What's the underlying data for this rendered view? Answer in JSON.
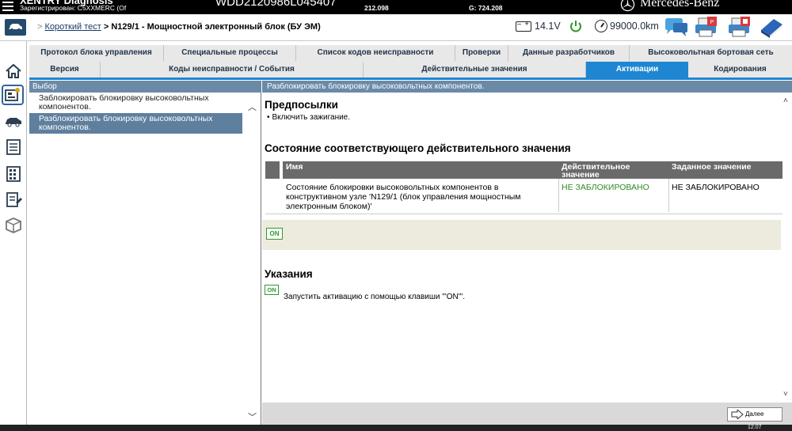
{
  "topbar": {
    "brand": "XENTRY Diagnosis",
    "registered": "Зарегистрирован: C5XXMERC (Of",
    "vin": "WDD2120986L045407",
    "code": "212.098",
    "gcode": "G: 724.208",
    "mb_text": "Mercedes-Benz"
  },
  "header": {
    "breadcrumb_sep": ">",
    "breadcrumb_link": "Короткий тест",
    "breadcrumb_current": "> N129/1 - Мощностной электронный блок (БУ ЭМ)",
    "voltage": "14.1V",
    "mileage": "99000.0km"
  },
  "tabs": {
    "row1": [
      "Протокол блока управления",
      "Специальные процессы",
      "Список кодов неисправности",
      "Проверки",
      "Данные разработчиков",
      "Высоковольтная бортовая сеть"
    ],
    "row2": [
      "Версия",
      "Коды неисправности / События",
      "Действительные значения",
      "Активации",
      "Кодирования"
    ]
  },
  "left_panel": {
    "title": "Выбор",
    "items": [
      "Заблокировать блокировку высоковольтных компонентов.",
      "Разблокировать блокировку высоковольтных компонентов."
    ]
  },
  "right_panel": {
    "title": "Разблокировать блокировку высоковольтных компонентов.",
    "prereq_heading": "Предпосылки",
    "prereq_item": "Включить зажигание.",
    "state_heading": "Состояние соответствующего действительного значения",
    "table": {
      "col_name": "Имя",
      "col_actual": "Действительное значение",
      "col_target": "Заданное значение",
      "row_name": "Состояние блокировки высоковольтных компонентов в конструктивном узле 'N129/1 (блок управления мощностным электронным блоком)'",
      "row_actual": "НЕ ЗАБЛОКИРОВАНО",
      "row_target": "НЕ ЗАБЛОКИРОВАНО"
    },
    "on_label": "ON",
    "hints_heading": "Указания",
    "hint_text": "Запустить активацию с помощью клавиши \"'ON'\"."
  },
  "footer": {
    "next_label": "Далее"
  },
  "taskbar": {
    "clock": "12:07"
  },
  "colors": {
    "accent_tab": "#1e86d2",
    "panel_header": "#6a8aa8",
    "actual_value": "#2c8b22"
  }
}
